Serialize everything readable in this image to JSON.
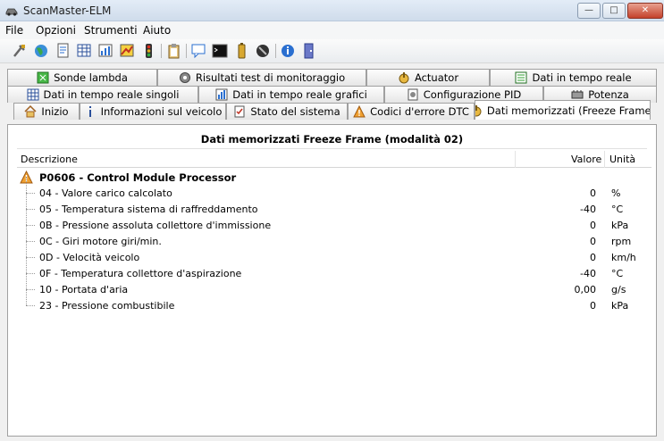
{
  "window": {
    "title": "ScanMaster-ELM"
  },
  "menu": [
    "File",
    "Opzioni",
    "Strumenti",
    "Aiuto"
  ],
  "tabs": {
    "row1": [
      "Sonde lambda",
      "Risultati test di monitoraggio",
      "Actuator",
      "Dati in tempo reale"
    ],
    "row2": [
      "Dati in tempo reale singoli",
      "Dati in tempo reale grafici",
      "Configurazione PID",
      "Potenza"
    ],
    "row3": [
      "Inizio",
      "Informazioni sul veicolo",
      "Stato del sistema",
      "Codici d'errore DTC",
      "Dati memorizzati (Freeze Frame)"
    ]
  },
  "panel": {
    "title": "Dati memorizzati Freeze Frame (modalità 02)",
    "columns": {
      "description": "Descrizione",
      "value": "Valore",
      "unit": "Unità"
    },
    "group": {
      "label": "P0606 - Control Module Processor"
    },
    "rows": [
      {
        "desc": "04 - Valore carico calcolato",
        "value": "0",
        "unit": "%"
      },
      {
        "desc": "05 - Temperatura sistema di raffreddamento",
        "value": "-40",
        "unit": "°C"
      },
      {
        "desc": "0B - Pressione assoluta collettore d'immissione",
        "value": "0",
        "unit": "kPa"
      },
      {
        "desc": "0C - Giri motore giri/min.",
        "value": "0",
        "unit": "rpm"
      },
      {
        "desc": "0D - Velocità veicolo",
        "value": "0",
        "unit": "km/h"
      },
      {
        "desc": "0F - Temperatura collettore d'aspirazione",
        "value": "-40",
        "unit": "°C"
      },
      {
        "desc": "10 - Portata d'aria",
        "value": "0,00",
        "unit": "g/s"
      },
      {
        "desc": "23 - Pressione combustibile",
        "value": "0",
        "unit": "kPa"
      }
    ]
  },
  "colors": {
    "warning": "#f0a030",
    "accent": "#2a6fd0"
  }
}
